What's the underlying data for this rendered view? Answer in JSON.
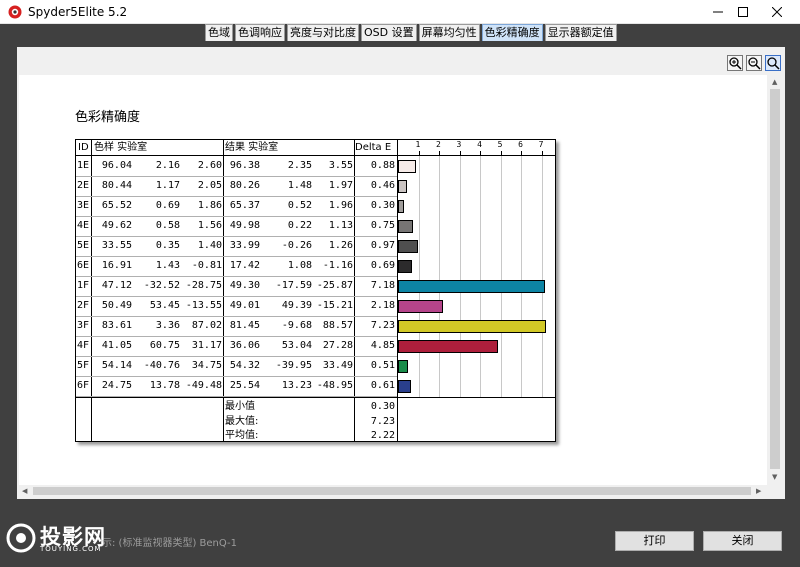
{
  "window": {
    "title": "Spyder5Elite 5.2"
  },
  "tabs": [
    {
      "label": "色域",
      "active": false
    },
    {
      "label": "色调响应",
      "active": false
    },
    {
      "label": "亮度与对比度",
      "active": false
    },
    {
      "label": "OSD 设置",
      "active": false
    },
    {
      "label": "屏幕均匀性",
      "active": false
    },
    {
      "label": "色彩精确度",
      "active": true
    },
    {
      "label": "显示器额定值",
      "active": false
    }
  ],
  "zoom_controls": [
    "zoom-in-icon",
    "zoom-out-icon",
    "zoom-fit-icon"
  ],
  "report": {
    "title": "色彩精确度",
    "headers": {
      "id": "ID",
      "sample": "色样 实验室",
      "result": "结果 实验室",
      "delta": "Delta E"
    },
    "rows": [
      {
        "id": "1E",
        "s": [
          "96.04",
          "2.16",
          "2.60"
        ],
        "r": [
          "96.38",
          "2.35",
          "3.55"
        ],
        "de": "0.88",
        "color": "#f6ebe8"
      },
      {
        "id": "2E",
        "s": [
          "80.44",
          "1.17",
          "2.05"
        ],
        "r": [
          "80.26",
          "1.48",
          "1.97"
        ],
        "de": "0.46",
        "color": "#cac4c2"
      },
      {
        "id": "3E",
        "s": [
          "65.52",
          "0.69",
          "1.86"
        ],
        "r": [
          "65.37",
          "0.52",
          "1.96"
        ],
        "de": "0.30",
        "color": "#a09d9b"
      },
      {
        "id": "4E",
        "s": [
          "49.62",
          "0.58",
          "1.56"
        ],
        "r": [
          "49.98",
          "0.22",
          "1.13"
        ],
        "de": "0.75",
        "color": "#777574"
      },
      {
        "id": "5E",
        "s": [
          "33.55",
          "0.35",
          "1.40"
        ],
        "r": [
          "33.99",
          "-0.26",
          "1.26"
        ],
        "de": "0.97",
        "color": "#4f4f4f"
      },
      {
        "id": "6E",
        "s": [
          "16.91",
          "1.43",
          "-0.81"
        ],
        "r": [
          "17.42",
          "1.08",
          "-1.16"
        ],
        "de": "0.69",
        "color": "#2c2b2c"
      },
      {
        "id": "1F",
        "s": [
          "47.12",
          "-32.52",
          "-28.75"
        ],
        "r": [
          "49.30",
          "-17.59",
          "-25.87"
        ],
        "de": "7.18",
        "color": "#0d84a4"
      },
      {
        "id": "2F",
        "s": [
          "50.49",
          "53.45",
          "-13.55"
        ],
        "r": [
          "49.01",
          "49.39",
          "-15.21"
        ],
        "de": "2.18",
        "color": "#b5448a"
      },
      {
        "id": "3F",
        "s": [
          "83.61",
          "3.36",
          "87.02"
        ],
        "r": [
          "81.45",
          "-9.68",
          "88.57"
        ],
        "de": "7.23",
        "color": "#d1c826"
      },
      {
        "id": "4F",
        "s": [
          "41.05",
          "60.75",
          "31.17"
        ],
        "r": [
          "36.06",
          "53.04",
          "27.28"
        ],
        "de": "4.85",
        "color": "#ae1f3c"
      },
      {
        "id": "5F",
        "s": [
          "54.14",
          "-40.76",
          "34.75"
        ],
        "r": [
          "54.32",
          "-39.95",
          "33.49"
        ],
        "de": "0.51",
        "color": "#198c4a"
      },
      {
        "id": "6F",
        "s": [
          "24.75",
          "13.78",
          "-49.48"
        ],
        "r": [
          "25.54",
          "13.23",
          "-48.95"
        ],
        "de": "0.61",
        "color": "#2a3f8c"
      }
    ],
    "summary": [
      {
        "label": "最小值",
        "value": "0.30"
      },
      {
        "label": "最大值:",
        "value": "7.23"
      },
      {
        "label": "平均值:",
        "value": "2.22"
      }
    ]
  },
  "chart_data": {
    "type": "bar",
    "orientation": "horizontal",
    "categories": [
      "1E",
      "2E",
      "3E",
      "4E",
      "5E",
      "6E",
      "1F",
      "2F",
      "3F",
      "4F",
      "5F",
      "6F"
    ],
    "values": [
      0.88,
      0.46,
      0.3,
      0.75,
      0.97,
      0.69,
      7.18,
      2.18,
      7.23,
      4.85,
      0.51,
      0.61
    ],
    "colors": [
      "#f6ebe8",
      "#cac4c2",
      "#a09d9b",
      "#777574",
      "#4f4f4f",
      "#2c2b2c",
      "#0d84a4",
      "#b5448a",
      "#d1c826",
      "#ae1f3c",
      "#198c4a",
      "#2a3f8c"
    ],
    "xticks": [
      "1",
      "2",
      "3",
      "4",
      "5",
      "6",
      "7"
    ],
    "xlim": [
      0,
      7.7
    ],
    "grid": true
  },
  "footer": {
    "logo_text": "投影网",
    "logo_sub": "TOUYING.COM",
    "info": "示: (标准监视器类型) BenQ-1",
    "print_label": "打印",
    "close_label": "关闭"
  },
  "colors": {
    "accent": "#cfe3f8",
    "background": "#404040"
  }
}
